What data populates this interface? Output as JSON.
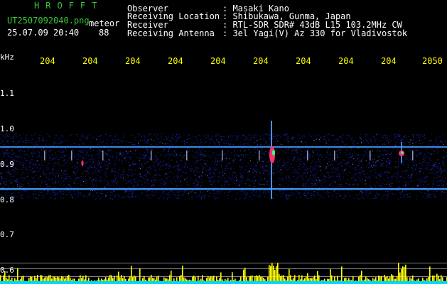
{
  "app": {
    "title": "HROFFT",
    "filename": "UT2507092040.png",
    "label": "meteor",
    "datetime": "25.07.09 20:40",
    "count": "88"
  },
  "header": {
    "fields": [
      {
        "label": "Observer",
        "value": ": Masaki Kano"
      },
      {
        "label": "Receiving Location",
        "value": ": Shibukawa, Gunma, Japan"
      },
      {
        "label": "Receiver",
        "value": ": RTL-SDR SDR# 43dB L15 103.2MHz CW"
      },
      {
        "label": "Receiving Antenna",
        "value": ": 3el Yagi(V) Az 330 for Vladivostok"
      }
    ]
  },
  "axis": {
    "unit": "kHz",
    "y_ticks": [
      "1.1",
      "1.0",
      "0.9",
      "0.8",
      "0.7",
      "0.6"
    ],
    "x_ticks": [
      "204",
      "204",
      "204",
      "204",
      "204",
      "204",
      "204",
      "204",
      "204",
      "2050"
    ]
  },
  "colors": {
    "background": "#000000",
    "noise": "#1a2ad8",
    "band_line": "#4aa0ff",
    "meteor_head": "#ff3070",
    "meteor_core": "#40ff80",
    "bars": "#ffff00",
    "baseline": "#00d8ff",
    "text": "#ffffff",
    "title": "#39c739",
    "ticks": "#ffff00"
  }
}
